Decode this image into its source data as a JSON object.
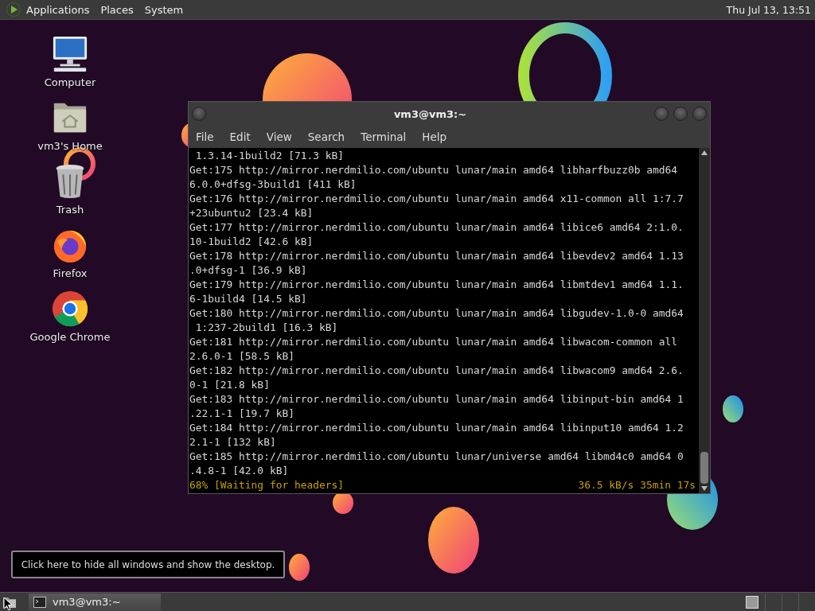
{
  "top_panel": {
    "menus": [
      {
        "label": "Applications"
      },
      {
        "label": "Places"
      },
      {
        "label": "System"
      }
    ],
    "clock": "Thu Jul 13, 13:51"
  },
  "desktop_icons": [
    {
      "kind": "computer",
      "label": "Computer"
    },
    {
      "kind": "home",
      "label": "vm3's Home"
    },
    {
      "kind": "trash",
      "label": "Trash"
    },
    {
      "kind": "firefox",
      "label": "Firefox"
    },
    {
      "kind": "chrome",
      "label": "Google Chrome"
    }
  ],
  "terminal": {
    "title": "vm3@vm3:~",
    "menu": [
      "File",
      "Edit",
      "View",
      "Search",
      "Terminal",
      "Help"
    ],
    "lines": [
      " 1.3.14-1build2 [71.3 kB]",
      "Get:175 http://mirror.nerdmilio.com/ubuntu lunar/main amd64 libharfbuzz0b amd64",
      "6.0.0+dfsg-3build1 [411 kB]",
      "Get:176 http://mirror.nerdmilio.com/ubuntu lunar/main amd64 x11-common all 1:7.7",
      "+23ubuntu2 [23.4 kB]",
      "Get:177 http://mirror.nerdmilio.com/ubuntu lunar/main amd64 libice6 amd64 2:1.0.",
      "10-1build2 [42.6 kB]",
      "Get:178 http://mirror.nerdmilio.com/ubuntu lunar/main amd64 libevdev2 amd64 1.13",
      ".0+dfsg-1 [36.9 kB]",
      "Get:179 http://mirror.nerdmilio.com/ubuntu lunar/main amd64 libmtdev1 amd64 1.1.",
      "6-1build4 [14.5 kB]",
      "Get:180 http://mirror.nerdmilio.com/ubuntu lunar/main amd64 libgudev-1.0-0 amd64",
      " 1:237-2build1 [16.3 kB]",
      "Get:181 http://mirror.nerdmilio.com/ubuntu lunar/main amd64 libwacom-common all",
      "2.6.0-1 [58.5 kB]",
      "Get:182 http://mirror.nerdmilio.com/ubuntu lunar/main amd64 libwacom9 amd64 2.6.",
      "0-1 [21.8 kB]",
      "Get:183 http://mirror.nerdmilio.com/ubuntu lunar/main amd64 libinput-bin amd64 1",
      ".22.1-1 [19.7 kB]",
      "Get:184 http://mirror.nerdmilio.com/ubuntu lunar/main amd64 libinput10 amd64 1.2",
      "2.1-1 [132 kB]",
      "Get:185 http://mirror.nerdmilio.com/ubuntu lunar/universe amd64 libmd4c0 amd64 0",
      ".4.8-1 [42.0 kB]"
    ],
    "status_left": "68% [Waiting for headers]",
    "status_right": "36.5 kB/s 35min 17s"
  },
  "tooltip": "Click here to hide all windows and show the desktop.",
  "bottom_panel": {
    "tasks": [
      {
        "label": "vm3@vm3:~"
      }
    ]
  }
}
